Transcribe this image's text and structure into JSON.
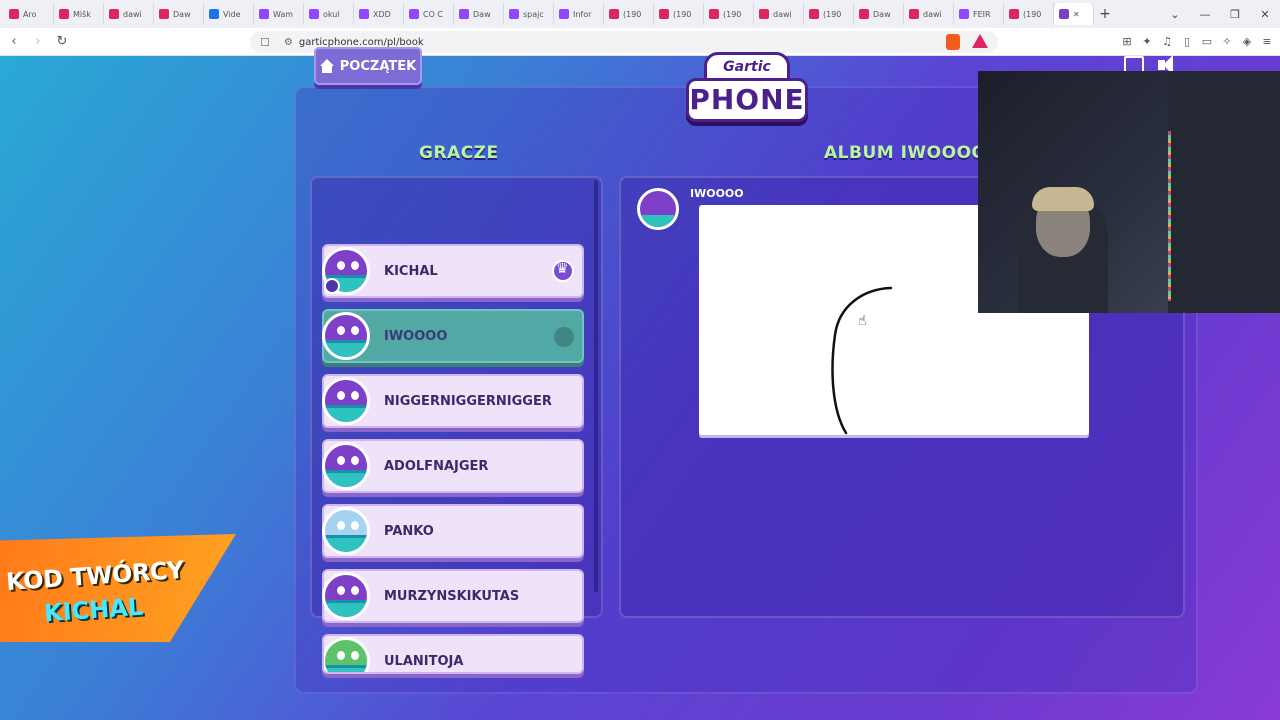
{
  "browser": {
    "tabs": [
      {
        "label": "Aro",
        "color": "#e0245e"
      },
      {
        "label": "Mišk",
        "color": "#e0245e"
      },
      {
        "label": "dawi",
        "color": "#e0245e"
      },
      {
        "label": "Daw",
        "color": "#e0245e"
      },
      {
        "label": "Vide",
        "color": "#1a73e8"
      },
      {
        "label": "Wam",
        "color": "#9146ff"
      },
      {
        "label": "okul",
        "color": "#9146ff"
      },
      {
        "label": "XDD",
        "color": "#9146ff"
      },
      {
        "label": "CO C",
        "color": "#9146ff"
      },
      {
        "label": "Daw",
        "color": "#9146ff"
      },
      {
        "label": "spajc",
        "color": "#9146ff"
      },
      {
        "label": "Infor",
        "color": "#9146ff"
      },
      {
        "label": "(190",
        "color": "#e0245e"
      },
      {
        "label": "(190",
        "color": "#e0245e"
      },
      {
        "label": "(190",
        "color": "#e0245e"
      },
      {
        "label": "dawi",
        "color": "#e0245e"
      },
      {
        "label": "(190",
        "color": "#e0245e"
      },
      {
        "label": "Daw",
        "color": "#e0245e"
      },
      {
        "label": "dawi",
        "color": "#e0245e"
      },
      {
        "label": "FEIR",
        "color": "#9146ff"
      },
      {
        "label": "(190",
        "color": "#e0245e"
      }
    ],
    "active_tab_color": "#7d3fc9",
    "url": "garticphone.com/pl/book"
  },
  "game": {
    "home_label": "POCZĄTEK",
    "logo_top": "Gartic",
    "logo_bottom": "PHONE",
    "players_title": "GRACZE",
    "album_title": "ALBUM IWOOOO",
    "players": [
      {
        "name": "KICHAL"
      },
      {
        "name": "IWOOOO"
      },
      {
        "name": "NIGGERNIGGERNIGGER"
      },
      {
        "name": "ADOLFNAJGER"
      },
      {
        "name": "PANKO"
      },
      {
        "name": "MURZYNSKIKUTAS"
      },
      {
        "name": "ULANITOJA"
      }
    ],
    "album_author": "IWOOOO",
    "accent": "#b8f5a0"
  },
  "overlay": {
    "creator_line1": "KOD TWÓRCY",
    "creator_line2": "KICHAL"
  }
}
